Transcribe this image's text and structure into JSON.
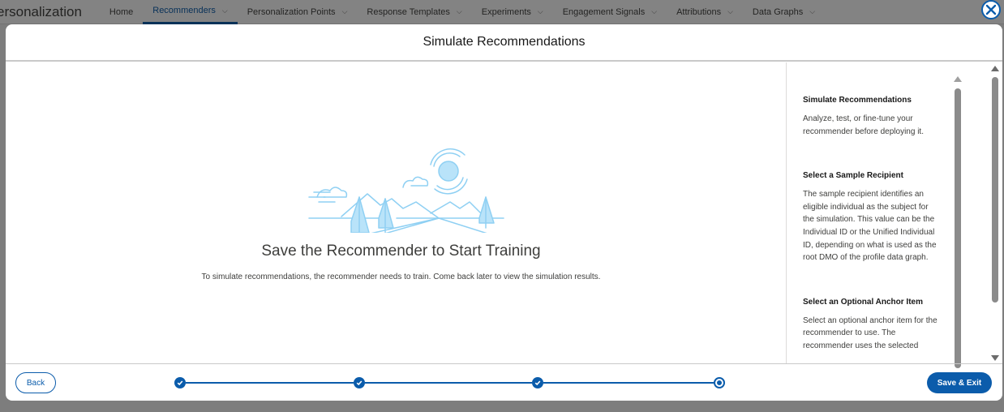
{
  "background_app": {
    "app_name": "ersonalization",
    "tabs": [
      {
        "label": "Home"
      },
      {
        "label": "Recommenders"
      },
      {
        "label": "Personalization Points"
      },
      {
        "label": "Response Templates"
      },
      {
        "label": "Experiments"
      },
      {
        "label": "Engagement Signals"
      },
      {
        "label": "Attributions"
      },
      {
        "label": "Data Graphs"
      }
    ]
  },
  "modal": {
    "title": "Simulate Recommendations",
    "empty_state": {
      "title": "Save the Recommender to Start Training",
      "description": "To simulate recommendations, the recommender needs to train. Come back later to view the simulation results."
    },
    "help": [
      {
        "heading": "Simulate Recommendations",
        "text": "Analyze, test, or fine-tune your recommender before deploying it."
      },
      {
        "heading": "Select a Sample Recipient",
        "text": "The sample recipient identifies an eligible individual as the subject for the simulation. This value can be the Individual ID or the Unified Individual ID, depending on what is used as the root DMO of the profile data graph."
      },
      {
        "heading": "Select an Optional Anchor Item",
        "text": "Select an optional anchor item for the recommender to use. The recommender uses the selected"
      }
    ],
    "footer": {
      "back_label": "Back",
      "save_label": "Save & Exit",
      "steps": [
        {
          "state": "complete"
        },
        {
          "state": "complete"
        },
        {
          "state": "complete"
        },
        {
          "state": "current"
        }
      ]
    }
  },
  "colors": {
    "brand": "#0b5cab",
    "illustration": "#8fd0f3"
  }
}
